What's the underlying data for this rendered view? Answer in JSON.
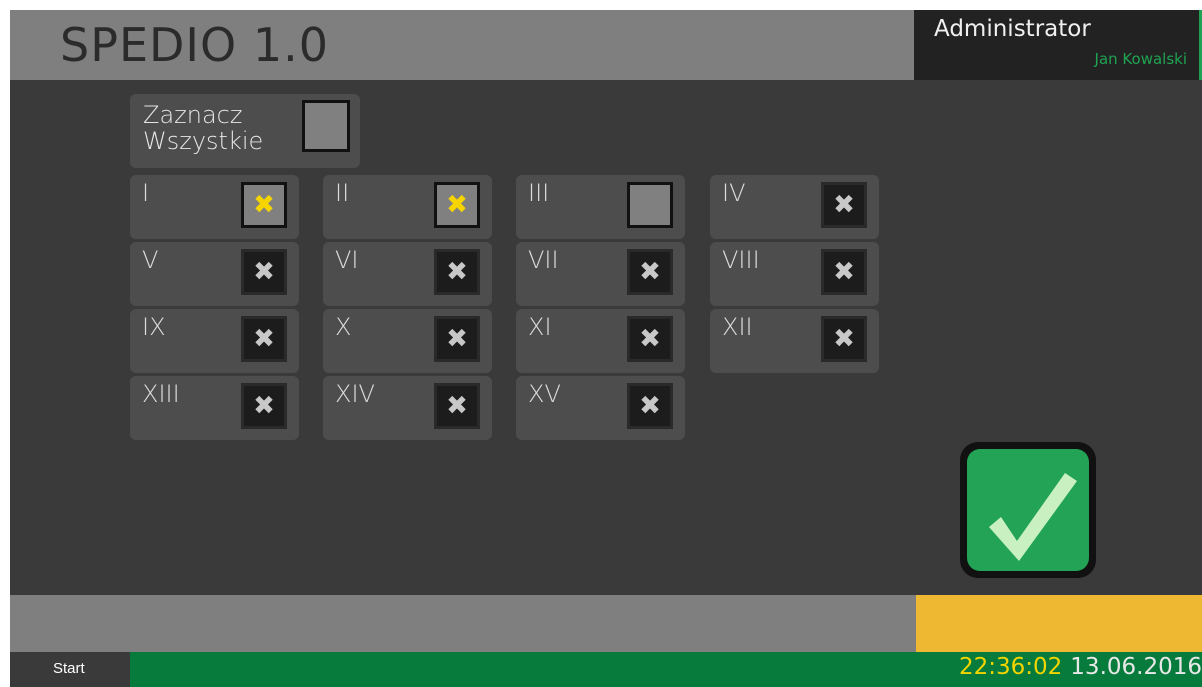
{
  "header": {
    "title": "SPEDIO 1.0"
  },
  "user": {
    "role": "Administrator",
    "name": "Jan Kowalski"
  },
  "select_all": {
    "label": "Zaznacz\nWszystkie",
    "checked": false
  },
  "items": [
    {
      "label": "I",
      "state": "checked"
    },
    {
      "label": "II",
      "state": "checked"
    },
    {
      "label": "III",
      "state": "unchecked"
    },
    {
      "label": "IV",
      "state": "disabled"
    },
    {
      "label": "V",
      "state": "disabled"
    },
    {
      "label": "VI",
      "state": "disabled"
    },
    {
      "label": "VII",
      "state": "disabled"
    },
    {
      "label": "VIII",
      "state": "disabled"
    },
    {
      "label": "IX",
      "state": "disabled"
    },
    {
      "label": "X",
      "state": "disabled"
    },
    {
      "label": "XI",
      "state": "disabled"
    },
    {
      "label": "XII",
      "state": "disabled"
    },
    {
      "label": "XIII",
      "state": "disabled"
    },
    {
      "label": "XIV",
      "state": "disabled"
    },
    {
      "label": "XV",
      "state": "disabled"
    }
  ],
  "taskbar": {
    "start_label": "Start",
    "time": "22:36:02",
    "date": "13.06.2016"
  },
  "colors": {
    "accent_green": "#23a355",
    "check_yellow": "#f5d400",
    "status_orange": "#efb832",
    "taskbar_green": "#067b3b"
  },
  "icons": {
    "confirm": "checkmark-icon",
    "checked_mark": "x-mark-icon"
  }
}
